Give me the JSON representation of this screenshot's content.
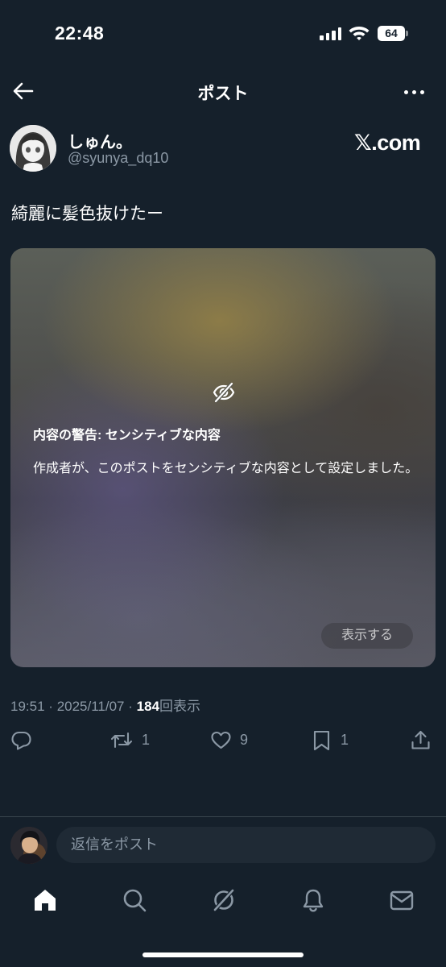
{
  "status_bar": {
    "time": "22:48",
    "battery": "64"
  },
  "header": {
    "title": "ポスト"
  },
  "post": {
    "author": {
      "display_name": "しゅん。",
      "handle": "@syunya_dq10"
    },
    "source_label": "𝕏.com",
    "text": "綺麗に髪色抜けたー",
    "media_warning": {
      "title": "内容の警告: センシティブな内容",
      "body": "作成者が、このポストをセンシティブな内容として設定しました。",
      "show_button": "表示する"
    },
    "meta": {
      "time": "19:51",
      "separator": "·",
      "date": "2025/11/07",
      "views": "184",
      "views_label": "回表示"
    },
    "actions": {
      "retweets": "1",
      "likes": "9",
      "bookmarks": "1"
    }
  },
  "reply": {
    "placeholder": "返信をポスト"
  },
  "colors": {
    "background": "#15202b",
    "secondary_text": "#8b98a5",
    "divider": "#38444d"
  }
}
